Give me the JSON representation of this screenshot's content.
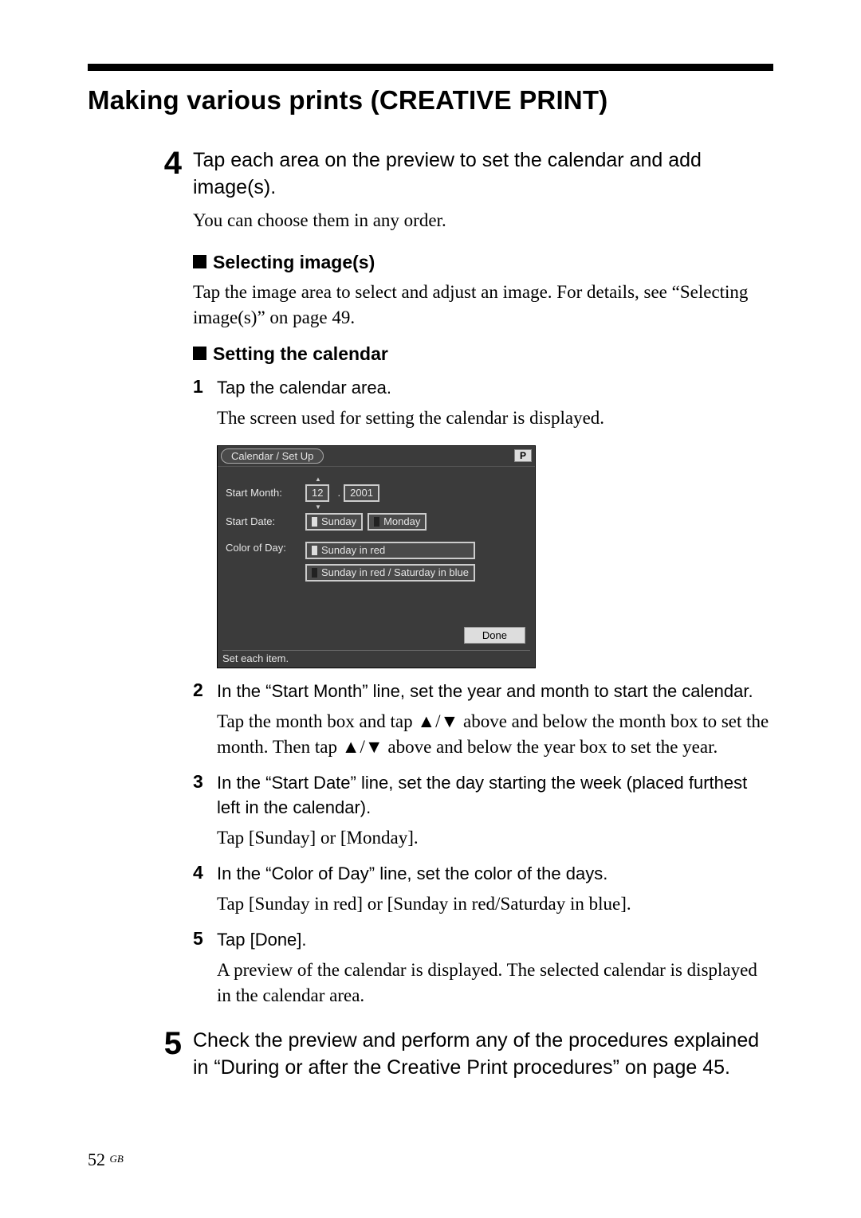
{
  "section_title": "Making various prints (CREATIVE PRINT)",
  "step4": {
    "num": "4",
    "title": "Tap each area on the preview to set the calendar and add image(s).",
    "note": "You can choose them in any order."
  },
  "sel_images": {
    "heading": "Selecting image(s)",
    "body": "Tap the image area to select and adjust an image.  For details, see “Selecting image(s)” on page 49."
  },
  "set_cal": {
    "heading": "Setting the calendar"
  },
  "sub1": {
    "num": "1",
    "title": "Tap the calendar area.",
    "body": "The screen used for setting the calendar is displayed."
  },
  "ui": {
    "title": "Calendar / Set Up",
    "p": "P",
    "labels": {
      "start_month": "Start Month:",
      "start_date": "Start Date:",
      "color_of_day": "Color of Day:"
    },
    "month": "12",
    "dot": ".",
    "year": "2001",
    "sunday": "Sunday",
    "monday": "Monday",
    "color1": "Sunday in red",
    "color2": "Sunday in red / Saturday in blue",
    "done": "Done",
    "footer": "Set each item."
  },
  "sub2": {
    "num": "2",
    "title": "In the “Start Month” line, set the year and month to start the calendar.",
    "body": "Tap the month box and tap ▲/▼ above and below the month box to set the month. Then tap ▲/▼ above and below the year box to set the year."
  },
  "sub3": {
    "num": "3",
    "title": "In the “Start Date” line, set the day starting the week (placed furthest left in the calendar).",
    "body": "Tap [Sunday] or [Monday]."
  },
  "sub4": {
    "num": "4",
    "title": "In the “Color of Day” line, set the color of the days.",
    "body": "Tap [Sunday in red] or [Sunday in red/Saturday in blue]."
  },
  "sub5": {
    "num": "5",
    "title": "Tap [Done].",
    "body": "A preview of the calendar is displayed.  The selected calendar is displayed in the calendar area."
  },
  "step5": {
    "num": "5",
    "title": "Check the preview and perform any of the procedures explained in “During or after the Creative Print procedures” on page 45."
  },
  "page_number": "52",
  "page_region": "GB"
}
